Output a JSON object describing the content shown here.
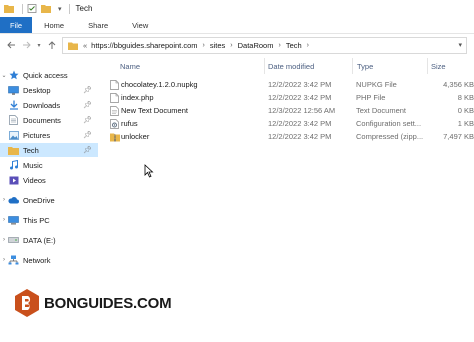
{
  "window": {
    "title": "Tech"
  },
  "ribbon": {
    "tabs": [
      "File",
      "Home",
      "Share",
      "View"
    ]
  },
  "address": {
    "crumbs": [
      "https://bbguides.sharepoint.com",
      "sites",
      "DataRoom",
      "Tech"
    ],
    "overflow": "«"
  },
  "columns": {
    "name": "Name",
    "date": "Date modified",
    "type": "Type",
    "size": "Size"
  },
  "files": [
    {
      "name": "chocolatey.1.2.0.nupkg",
      "date": "12/2/2022 3:42 PM",
      "type": "NUPKG File",
      "size": "4,356 KB",
      "icon": "file-icon"
    },
    {
      "name": "index.php",
      "date": "12/2/2022 3:42 PM",
      "type": "PHP File",
      "size": "8 KB",
      "icon": "file-icon"
    },
    {
      "name": "New Text Document",
      "date": "12/3/2022 12:56 AM",
      "type": "Text Document",
      "size": "0 KB",
      "icon": "file-icon"
    },
    {
      "name": "rufus",
      "date": "12/2/2022 3:42 PM",
      "type": "Configuration sett...",
      "size": "1 KB",
      "icon": "config-file-icon"
    },
    {
      "name": "unlocker",
      "date": "12/2/2022 3:42 PM",
      "type": "Compressed (zipp...",
      "size": "7,497 KB",
      "icon": "zip-folder-icon"
    }
  ],
  "sidebar": {
    "items": [
      {
        "label": "Quick access",
        "icon": "star-icon",
        "level": 0,
        "expand": "v"
      },
      {
        "label": "Desktop",
        "icon": "desktop-icon",
        "level": 1,
        "pinned": true
      },
      {
        "label": "Downloads",
        "icon": "download-icon",
        "level": 1,
        "pinned": true
      },
      {
        "label": "Documents",
        "icon": "documents-icon",
        "level": 1,
        "pinned": true
      },
      {
        "label": "Pictures",
        "icon": "pictures-icon",
        "level": 1,
        "pinned": true
      },
      {
        "label": "Tech",
        "icon": "folder-icon",
        "level": 1,
        "pinned": true,
        "selected": true
      },
      {
        "label": "Music",
        "icon": "music-icon",
        "level": 1
      },
      {
        "label": "Videos",
        "icon": "videos-icon",
        "level": 1
      },
      {
        "label": "OneDrive",
        "icon": "cloud-icon",
        "level": 0,
        "expand": ">"
      },
      {
        "label": "This PC",
        "icon": "pc-icon",
        "level": 0,
        "expand": ">"
      },
      {
        "label": "DATA (E:)",
        "icon": "drive-icon",
        "level": 0,
        "expand": ">"
      },
      {
        "label": "Network",
        "icon": "network-icon",
        "level": 0,
        "expand": ">"
      }
    ]
  },
  "watermark": {
    "text": "BONGUIDES.COM"
  },
  "colors": {
    "accent": "#1f6fc5",
    "selection": "#cce8ff",
    "folder": "#e8b64a",
    "header_text": "#4d6082"
  }
}
